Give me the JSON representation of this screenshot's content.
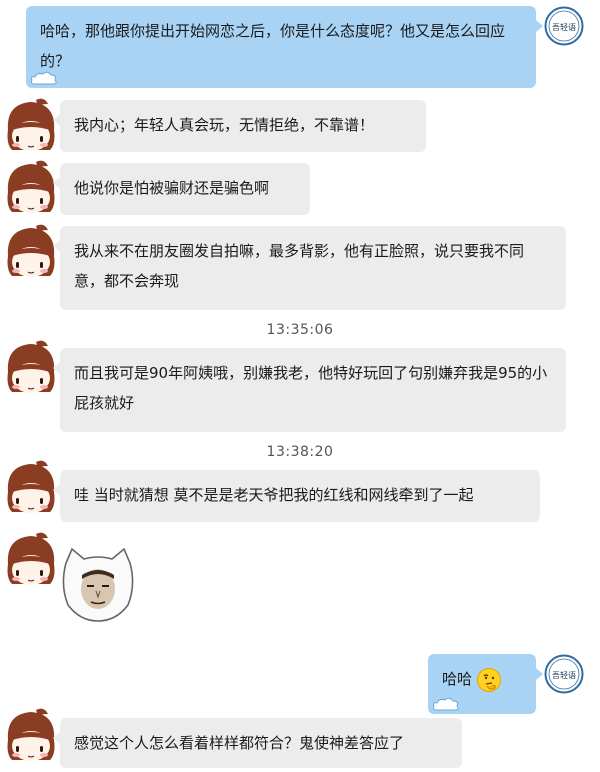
{
  "messages": [
    {
      "text": "哈哈，那他跟你提出开始网恋之后，你是什么态度呢？他又是怎么回应的？"
    },
    {
      "text": "我内心；年轻人真会玩，无情拒绝，不靠谱！"
    },
    {
      "text": "他说你是怕被骗财还是骗色啊"
    },
    {
      "text": "我从来不在朋友圈发自拍嘛，最多背影，他有正脸照，说只要我不同意，都不会奔现"
    },
    {
      "text": "而且我可是90年阿姨哦，别嫌我老，他特好玩回了句别嫌弃我是95的小屁孩就好"
    },
    {
      "text": "哇 当时就猜想 莫不是是老天爷把我的红线和网线牵到了一起"
    },
    {
      "text": "哈哈"
    },
    {
      "text": "感觉这个人怎么看着样样都符合？鬼使神差答应了"
    }
  ],
  "timestamps": [
    "13:35:06",
    "13:38:20"
  ],
  "right_avatar_text": "吾轻语",
  "colors": {
    "incoming_bubble": "#ececec",
    "outgoing_bubble": "#a8d3f5"
  },
  "icons": {
    "left_avatar": "cartoon-girl-avatar",
    "right_avatar": "logo-stamp-avatar",
    "sticker": "cat-face-sticker",
    "emoji": "thinking-face-emoji"
  }
}
